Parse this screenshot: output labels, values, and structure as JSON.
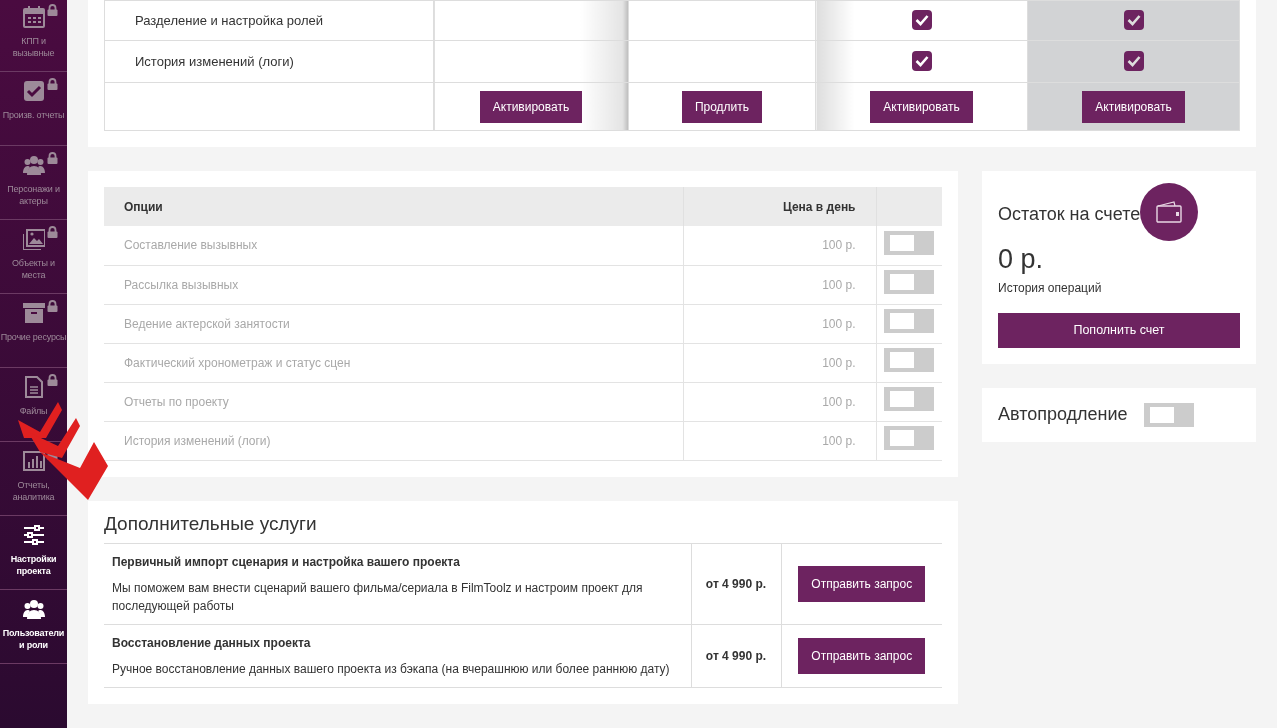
{
  "sidebar": {
    "items": [
      {
        "label": "КПП и вызывные",
        "kind": "calendar",
        "locked": true
      },
      {
        "label": "Произв. отчеты",
        "kind": "check",
        "locked": true
      },
      {
        "label": "Персонажи и актеры",
        "kind": "users",
        "locked": true
      },
      {
        "label": "Объекты и места",
        "kind": "image",
        "locked": true
      },
      {
        "label": "Прочие ресурсы",
        "kind": "archive",
        "locked": true
      },
      {
        "label": "Файлы",
        "kind": "file",
        "locked": true
      },
      {
        "label": "Отчеты, аналитика",
        "kind": "chart",
        "locked": true
      },
      {
        "label": "Настройки проекта",
        "kind": "sliders",
        "locked": false
      },
      {
        "label": "Пользователи и роли",
        "kind": "users",
        "locked": false
      }
    ]
  },
  "plans_table": {
    "features": [
      {
        "label": "Разделение и настройка ролей",
        "checks": [
          false,
          false,
          true,
          true
        ]
      },
      {
        "label": "История изменений (логи)",
        "checks": [
          false,
          false,
          true,
          true
        ]
      }
    ],
    "plans": [
      {
        "button": "Активировать",
        "highlighted": false
      },
      {
        "button": "Продлить",
        "highlighted": false
      },
      {
        "button": "Активировать",
        "highlighted": false
      },
      {
        "button": "Активировать",
        "highlighted": true
      }
    ]
  },
  "options": {
    "columns": [
      "Опции",
      "Цена в день"
    ],
    "rows": [
      {
        "name": "Составление вызывных",
        "price": "100 р.",
        "on": false,
        "disabled": true
      },
      {
        "name": "Рассылка вызывных",
        "price": "100 р.",
        "on": false,
        "disabled": true
      },
      {
        "name": "Ведение актерской занятости",
        "price": "100 р.",
        "on": false,
        "disabled": true
      },
      {
        "name": "Фактический хронометраж и статус сцен",
        "price": "100 р.",
        "on": false,
        "disabled": true
      },
      {
        "name": "Отчеты по проекту",
        "price": "100 р.",
        "on": false,
        "disabled": true
      },
      {
        "name": "История изменений (логи)",
        "price": "100 р.",
        "on": false,
        "disabled": true
      }
    ]
  },
  "balance": {
    "title": "Остаток на счете",
    "amount": "0 р.",
    "history_link": "История операций",
    "button": "Пополнить счет"
  },
  "autorenew": {
    "label": "Автопродление",
    "on": false
  },
  "services": {
    "title": "Дополнительные услуги",
    "items": [
      {
        "name": "Первичный импорт сценария и настройка вашего проекта",
        "description": "Мы поможем вам внести сценарий вашего фильма/сериала в FilmToolz и настроим проект для последующей работы",
        "price": "от 4 990 р.",
        "button": "Отправить запрос"
      },
      {
        "name": "Восстановление данных проекта",
        "description": "Ручное восстановление данных вашего проекта из бэкапа (на вчерашнюю или более раннюю дату)",
        "price": "от 4 990 р.",
        "button": "Отправить запрос"
      }
    ]
  }
}
